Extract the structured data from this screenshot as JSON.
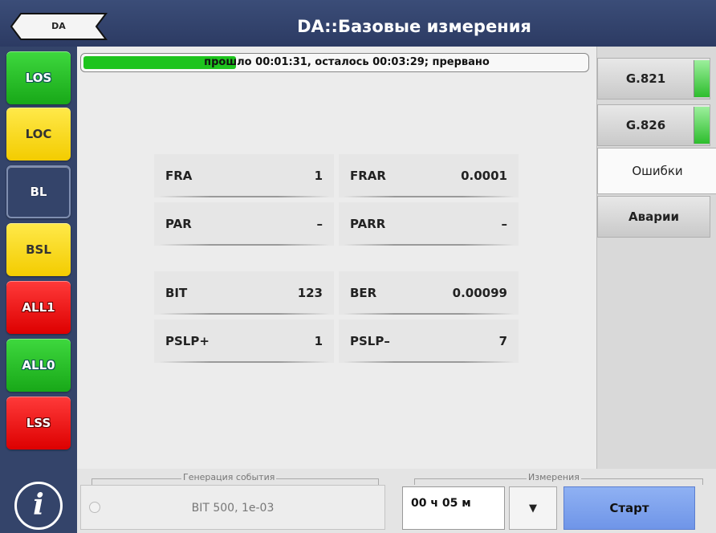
{
  "header": {
    "back_label": "DA",
    "title": "DA::Базовые измерения"
  },
  "alarms": [
    {
      "label": "LOS",
      "state": "green"
    },
    {
      "label": "LOC",
      "state": "yellow"
    },
    {
      "label": "BL",
      "state": "dark"
    },
    {
      "label": "BSL",
      "state": "yellow"
    },
    {
      "label": "ALL1",
      "state": "red"
    },
    {
      "label": "ALL0",
      "state": "green"
    },
    {
      "label": "LSS",
      "state": "red"
    }
  ],
  "progress": {
    "text": "прошло 00:01:31, осталось 00:03:29; прервано",
    "fraction": 0.3
  },
  "metrics": [
    {
      "key": "FRA",
      "value": "1"
    },
    {
      "key": "FRAR",
      "value": "0.0001"
    },
    {
      "key": "PAR",
      "value": "–"
    },
    {
      "key": "PARR",
      "value": "–"
    },
    {
      "key": "BIT",
      "value": "123"
    },
    {
      "key": "BER",
      "value": "0.00099"
    },
    {
      "key": "PSLP+",
      "value": "1"
    },
    {
      "key": "PSLP–",
      "value": "7"
    }
  ],
  "tabs": [
    {
      "label": "G.821"
    },
    {
      "label": "G.826"
    },
    {
      "label": "Ошибки"
    },
    {
      "label": "Аварии"
    }
  ],
  "bottom": {
    "event_group_title": "Генерация события",
    "event_text": "BIT  500, 1e-03",
    "measure_group_title": "Измерения",
    "duration": "00 ч 05 м",
    "dropdown_symbol": "▼",
    "start_label": "Старт"
  },
  "info_symbol": "i",
  "colors": {
    "background": "#3a4a6e",
    "progress_fill": "#1ec41e",
    "start_button": "#7fa3ee",
    "alarm_green": "#22b822",
    "alarm_yellow": "#f7d400",
    "alarm_red": "#ee0000"
  }
}
